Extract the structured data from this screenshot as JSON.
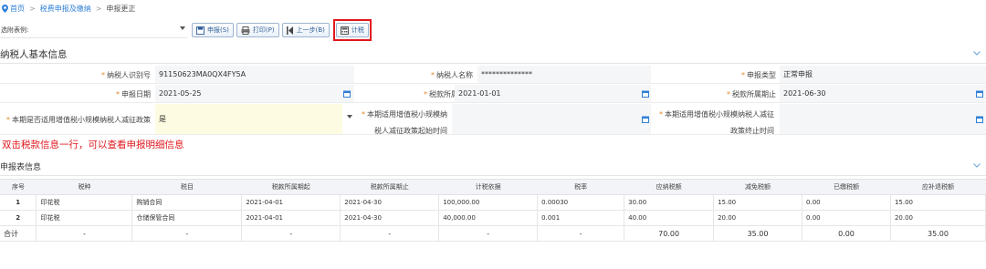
{
  "breadcrumb": {
    "home": "首页",
    "section": "税费申报及缴纳",
    "current": "申报更正"
  },
  "toolbar": {
    "form_select": "选附表例:",
    "declare": "申报(S)",
    "print": "打印(P)",
    "prev": "上一步(B)",
    "calc": "计税"
  },
  "taxpayer": {
    "title": "纳税人基本信息",
    "fields": [
      {
        "label": "纳税人识别号",
        "value": "91150623MA0QX4FY5A"
      },
      {
        "label": "纳税人名称",
        "value": "**************"
      },
      {
        "label": "申报类型",
        "value": "正常申报"
      },
      {
        "label": "申报日期",
        "value": "2021-05-25"
      },
      {
        "label": "税款所属期起",
        "value": "2021-01-01"
      },
      {
        "label": "税款所属期止",
        "value": "2021-06-30"
      },
      {
        "label": "本期是否适用增值税小规模纳税人减征政策",
        "value": "是"
      },
      {
        "label_line1": "本期适用增值税小规模纳",
        "label_line2": "税人减征政策起始时间",
        "value": ""
      },
      {
        "label_line1": "本期适用增值税小规模纳税人减征",
        "label_line2": "政策终止时间",
        "value": ""
      }
    ]
  },
  "hint": "双击税款信息一行，可以查看申报明细信息",
  "declare_table": {
    "title": "申报表信息",
    "columns": [
      "序号",
      "税种",
      "税目",
      "税款所属期起",
      "税款所属期止",
      "计税依据",
      "税率",
      "应纳税额",
      "减免税额",
      "已缴税额",
      "应补退税额"
    ],
    "rows": [
      [
        "1",
        "印花税",
        "购销合同",
        "2021-04-01",
        "2021-04-30",
        "100,000.00",
        "0.00030",
        "30.00",
        "15.00",
        "0.00",
        "15.00"
      ],
      [
        "2",
        "印花税",
        "仓储保管合同",
        "2021-04-01",
        "2021-04-30",
        "40,000.00",
        "0.001",
        "40.00",
        "20.00",
        "0.00",
        "20.00"
      ]
    ],
    "total": [
      "合计",
      "-",
      "-",
      "-",
      "-",
      "-",
      "-",
      "70.00",
      "35.00",
      "0.00",
      "35.00"
    ]
  },
  "colors": {
    "accent": "#2f7fd6",
    "warning_red": "#e0171d",
    "field_bg": "#f5f6f8"
  },
  "icons": [
    "location-pin-icon",
    "print-icon",
    "back-arrow-icon",
    "calculator-icon",
    "calendar-icon",
    "chevron-down-icon",
    "save-icon"
  ]
}
